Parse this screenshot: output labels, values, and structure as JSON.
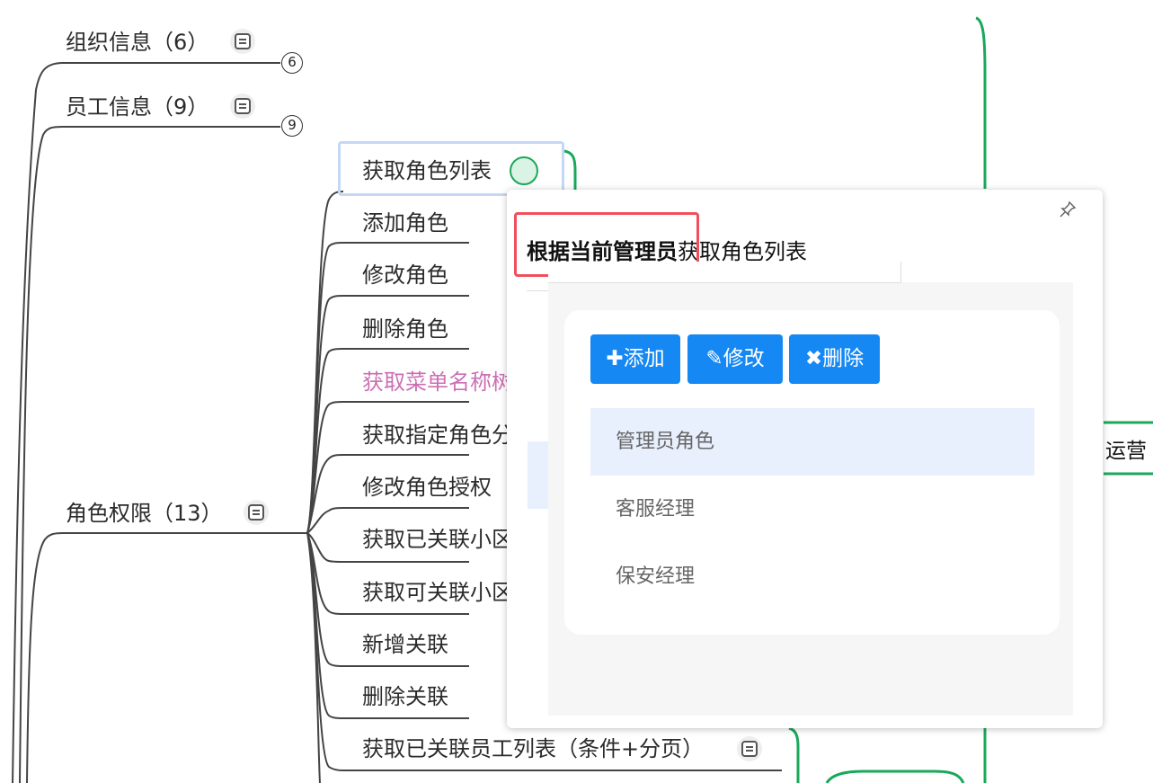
{
  "mindmap": {
    "top_nodes": [
      {
        "label": "组织信息（6）",
        "count": "6"
      },
      {
        "label": "员工信息（9）",
        "count": "9"
      },
      {
        "label": "角色权限（13）"
      }
    ],
    "role_children": [
      "获取角色列表",
      "添加角色",
      "修改角色",
      "删除角色",
      "获取菜单名称树",
      "获取指定角色分",
      "修改角色授权",
      "获取已关联小区",
      "获取可关联小区",
      "新增关联",
      "删除关联",
      "获取已关联员工列表（条件+分页）"
    ],
    "right_edge_label": "运营",
    "colors": {
      "branch": "#444444",
      "green": "#1aa85a",
      "pink": "#cc6fb5",
      "selection": "#c4d8f5"
    }
  },
  "note_popup": {
    "title_bold": "根据当前管理员",
    "title_rest": "获取角色列表",
    "pin_icon": "pin-icon",
    "buttons": [
      {
        "label": "✚添加",
        "icon": "plus-icon"
      },
      {
        "label": "✎修改",
        "icon": "edit-icon"
      },
      {
        "label": "✖删除",
        "icon": "delete-icon"
      }
    ],
    "roles": [
      "管理员角色",
      "客服经理",
      "保安经理"
    ],
    "selected_role": "管理员角色",
    "colors": {
      "button": "#1588f4",
      "highlight_border": "#f0505e",
      "selected_row": "#e8effd"
    }
  }
}
